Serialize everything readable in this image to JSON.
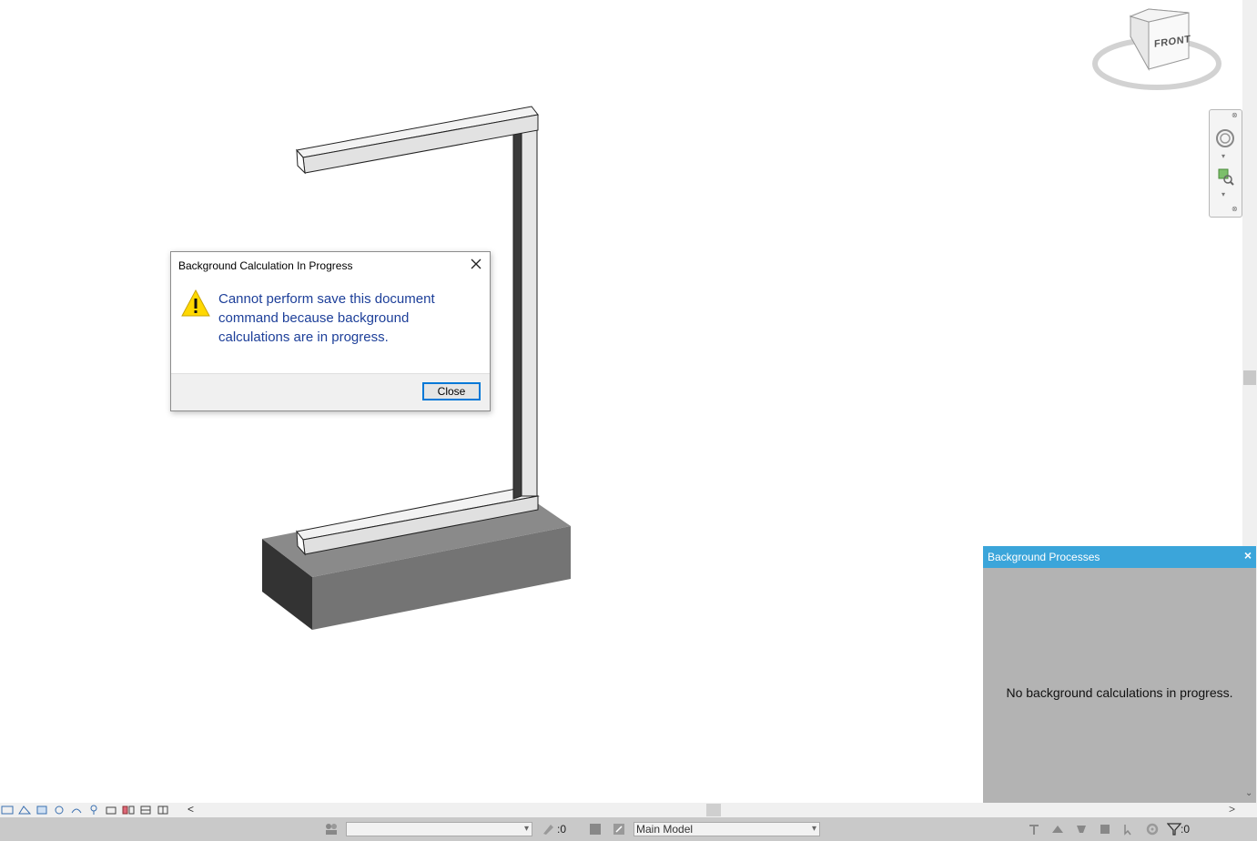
{
  "dialog": {
    "title": "Background Calculation In Progress",
    "message": "Cannot perform save this document command because background calculations are in progress.",
    "close_button": "Close"
  },
  "viewcube": {
    "face_label": "FRONT"
  },
  "background_processes": {
    "title": "Background Processes",
    "close_symbol": "×",
    "message": "No background calculations in progress."
  },
  "statusbar": {
    "selection_count": ":0",
    "model_label": "Main Model",
    "filter_count": ":0"
  },
  "scroll": {
    "left_arrow": "<",
    "right_arrow": ">",
    "down_arrow": "⌄"
  },
  "colors": {
    "accent": "#3ba5da",
    "dialog_text": "#1d3f99",
    "panel_bg": "#b3b3b3",
    "statusbar_bg": "#c9c9c9"
  }
}
